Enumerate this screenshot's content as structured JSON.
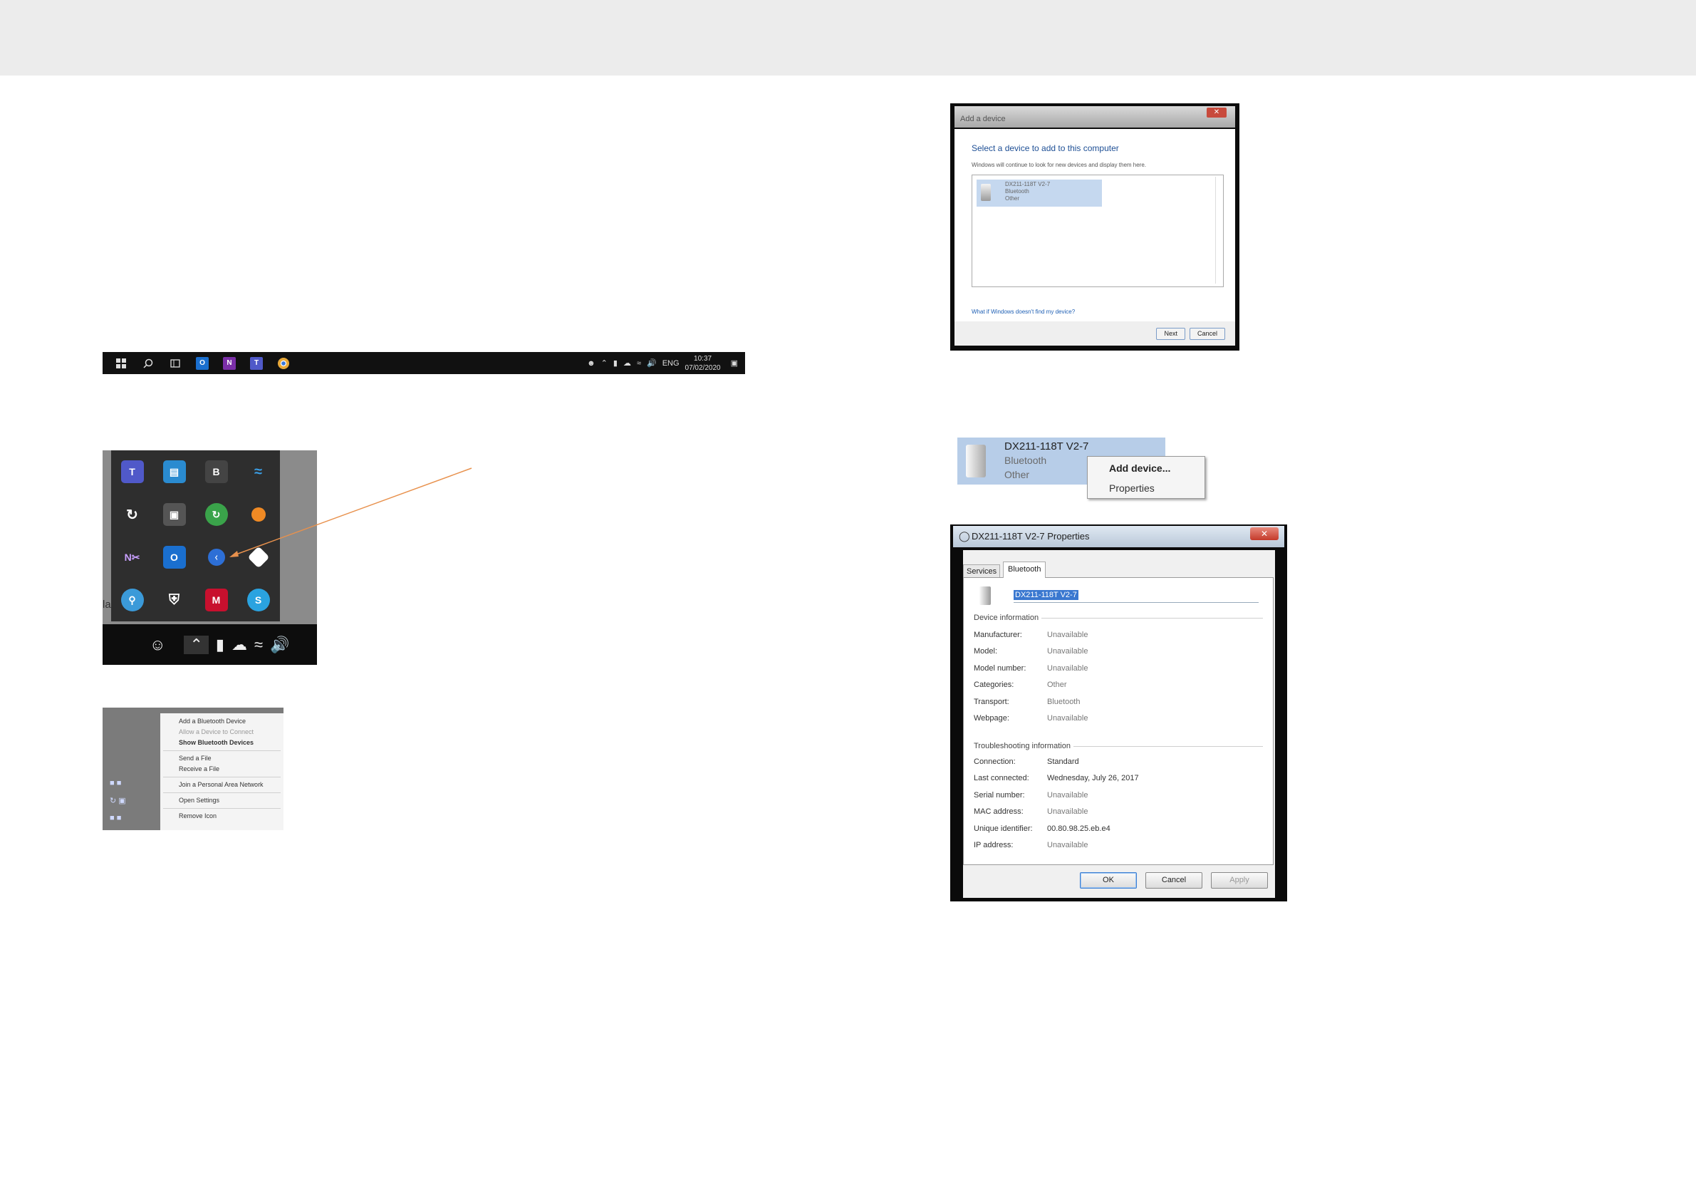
{
  "taskbar": {
    "clock_time": "10:37",
    "clock_date": "07/02/2020",
    "language": "ENG"
  },
  "context_menu": {
    "items": [
      "Add a Bluetooth Device",
      "Allow a Device to Connect",
      "Show Bluetooth Devices",
      "Send a File",
      "Receive a File",
      "Join a Personal Area Network",
      "Open Settings",
      "Remove Icon"
    ]
  },
  "add_device_dialog": {
    "title": "Add a device",
    "heading": "Select a device to add to this computer",
    "subheading": "Windows will continue to look for new devices and display them here.",
    "device_name": "DX211-118T V2-7",
    "device_type": "Bluetooth",
    "device_category": "Other",
    "help_link": "What if Windows doesn't find my device?",
    "next_label": "Next",
    "cancel_label": "Cancel"
  },
  "device_tile": {
    "name": "DX211-118T V2-7",
    "type": "Bluetooth",
    "category": "Other",
    "menu_items": [
      "Add device...",
      "Properties"
    ]
  },
  "properties_dialog": {
    "title": "DX211-118T V2-7 Properties",
    "tabs": [
      "Services",
      "Bluetooth"
    ],
    "device_name": "DX211-118T V2-7",
    "device_info_title": "Device information",
    "device_info": [
      {
        "key": "Manufacturer:",
        "value": "Unavailable"
      },
      {
        "key": "Model:",
        "value": "Unavailable"
      },
      {
        "key": "Model number:",
        "value": "Unavailable"
      },
      {
        "key": "Categories:",
        "value": "Other"
      },
      {
        "key": "Transport:",
        "value": "Bluetooth"
      },
      {
        "key": "Webpage:",
        "value": "Unavailable"
      }
    ],
    "troubleshooting_title": "Troubleshooting information",
    "troubleshooting": [
      {
        "key": "Connection:",
        "value": "Standard"
      },
      {
        "key": "Last connected:",
        "value": "Wednesday, July 26, 2017"
      },
      {
        "key": "Serial number:",
        "value": "Unavailable"
      },
      {
        "key": "MAC address:",
        "value": "Unavailable"
      },
      {
        "key": "Unique identifier:",
        "value": "00.80.98.25.eb.e4"
      },
      {
        "key": "IP address:",
        "value": "Unavailable"
      }
    ],
    "ok_label": "OK",
    "cancel_label": "Cancel",
    "apply_label": "Apply"
  },
  "colors": {
    "annotation_arrow": "#e8914d",
    "selection_blue": "#b7cde8",
    "taskbar": "#111111"
  }
}
